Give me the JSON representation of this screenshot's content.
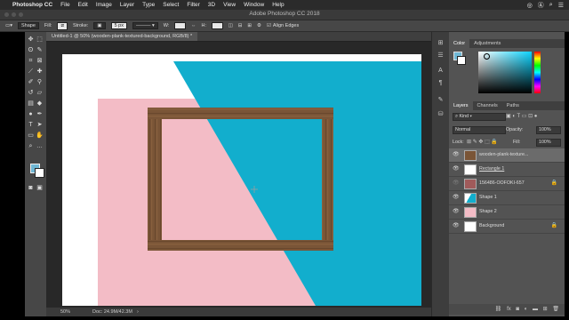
{
  "menubar": {
    "app_name": "Photoshop CC",
    "items": [
      "File",
      "Edit",
      "Image",
      "Layer",
      "Type",
      "Select",
      "Filter",
      "3D",
      "View",
      "Window",
      "Help"
    ]
  },
  "titlebar": {
    "title": "Adobe Photoshop CC 2018"
  },
  "options": {
    "mode": "Shape",
    "fill_label": "Fill:",
    "stroke_label": "Stroke:",
    "stroke_size": "5 px",
    "w_label": "W:",
    "h_label": "H:",
    "align_edges": "Align Edges"
  },
  "document": {
    "tab_title": "Untitled-1 @ 50% (wooden-plank-textured-background, RGB/8) *",
    "zoom": "50%",
    "doc_size": "Doc: 24.9M/42.3M"
  },
  "panels": {
    "color_tab": "Color",
    "adjustments_tab": "Adjustments",
    "layers_tab": "Layers",
    "channels_tab": "Channels",
    "paths_tab": "Paths",
    "kind_label": "Kind",
    "blend_mode": "Normal",
    "opacity_label": "Opacity:",
    "opacity_value": "100%",
    "lock_label": "Lock:",
    "fill_label": "Fill:",
    "fill_value": "100%"
  },
  "layers": [
    {
      "name": "wooden-plank-texture...",
      "selected": true
    },
    {
      "name": "Rectangle 1",
      "selected": false
    },
    {
      "name": "156486-OOFOKI-657",
      "selected": false
    },
    {
      "name": "Shape 1",
      "selected": false
    },
    {
      "name": "Shape 2",
      "selected": false
    },
    {
      "name": "Background",
      "selected": false
    }
  ],
  "colors": {
    "accent_blue": "#12aecd",
    "pink": "#f3bcc6",
    "wood": "#7a5537",
    "foreground_swatch": "#6fb7d4",
    "background_swatch": "#ffffff"
  }
}
